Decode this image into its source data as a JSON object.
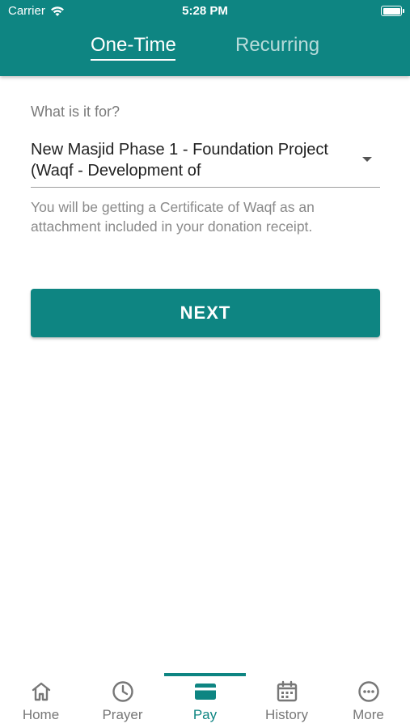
{
  "status_bar": {
    "carrier": "Carrier",
    "time": "5:28 PM"
  },
  "top_tabs": {
    "one_time": "One-Time",
    "recurring": "Recurring",
    "active": "One-Time"
  },
  "form": {
    "label": "What is it for?",
    "selected_value": "New Masjid Phase 1 - Foundation Project (Waqf - Development of",
    "helper_text": "You will be getting a Certificate of Waqf as an attachment included in your donation receipt."
  },
  "next_button": "NEXT",
  "bottom_nav": {
    "active": "Pay",
    "items": [
      {
        "label": "Home",
        "icon": "home-icon"
      },
      {
        "label": "Prayer",
        "icon": "clock-icon"
      },
      {
        "label": "Pay",
        "icon": "card-icon"
      },
      {
        "label": "History",
        "icon": "calendar-icon"
      },
      {
        "label": "More",
        "icon": "more-icon"
      }
    ]
  },
  "colors": {
    "primary": "#0e8582",
    "inactive": "#777777"
  }
}
